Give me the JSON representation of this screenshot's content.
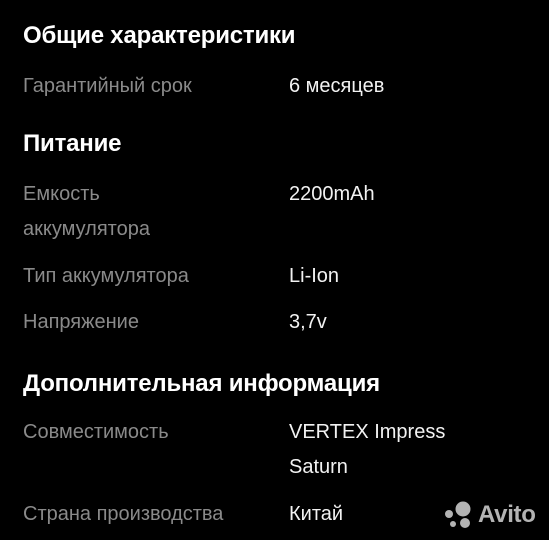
{
  "sections": [
    {
      "title": "Общие характеристики",
      "rows": [
        {
          "label": "Гарантийный срок",
          "value": "6 месяцев"
        }
      ]
    },
    {
      "title": "Питание",
      "rows": [
        {
          "label": "Емкость аккумулятора",
          "value": "2200mAh"
        },
        {
          "label": "Тип аккумулятора",
          "value": "Li-Ion"
        },
        {
          "label": "Напряжение",
          "value": "3,7v"
        }
      ]
    },
    {
      "title": "Дополнительная информация",
      "rows": [
        {
          "label": "Совместимость",
          "value": "VERTEX Impress Saturn"
        },
        {
          "label": "Страна производства",
          "value": "Китай"
        }
      ]
    }
  ],
  "watermark": {
    "text": "Avito",
    "icon": "avito-logo-icon",
    "colors": {
      "dot_blue": "#00aaff",
      "dot_green": "#97cf26",
      "dot_red": "#ff4053",
      "dot_purple": "#a169f7"
    }
  }
}
